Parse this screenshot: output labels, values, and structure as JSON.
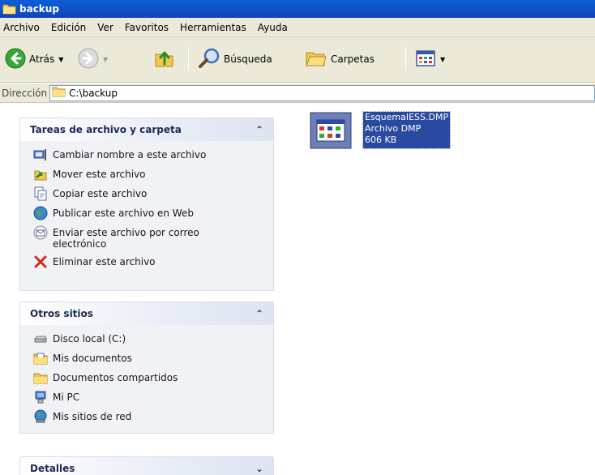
{
  "window": {
    "title": "backup"
  },
  "menu": [
    "Archivo",
    "Edición",
    "Ver",
    "Favoritos",
    "Herramientas",
    "Ayuda"
  ],
  "toolbar": {
    "back_label": "Atrás",
    "search_label": "Búsqueda",
    "folders_label": "Carpetas"
  },
  "address": {
    "label": "Dirección",
    "path": "C:\\backup"
  },
  "panels": {
    "tasks": {
      "title": "Tareas de archivo y carpeta",
      "items": [
        "Cambiar nombre a este archivo",
        "Mover este archivo",
        "Copiar este archivo",
        "Publicar este archivo en Web",
        "Enviar este archivo por correo electrónico",
        "Eliminar este archivo"
      ]
    },
    "other": {
      "title": "Otros sitios",
      "items": [
        "Disco local (C:)",
        "Mis documentos",
        "Documentos compartidos",
        "Mi PC",
        "Mis sitios de red"
      ]
    },
    "details": {
      "title": "Detalles"
    }
  },
  "file": {
    "name": "EsquemaIESS.DMP",
    "type": "Archivo DMP",
    "size": "606 KB"
  }
}
